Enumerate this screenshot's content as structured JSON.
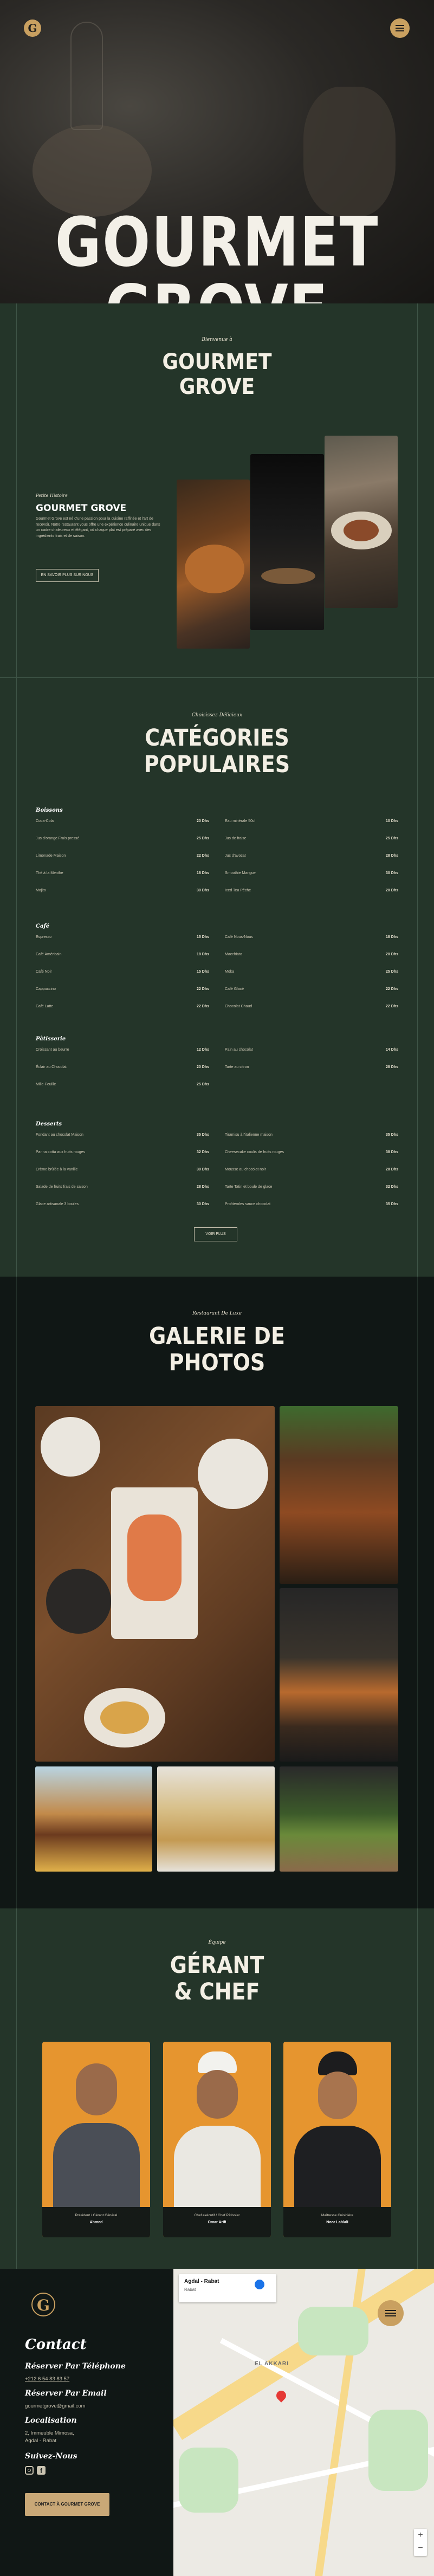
{
  "hero": {
    "title": "GOURMET GROVE",
    "logo_letter": "G"
  },
  "about": {
    "kicker": "Bienvenue à",
    "title_line1": "GOURMET",
    "title_line2": "GROVE",
    "small": "Petite Histoire",
    "name": "GOURMET GROVE",
    "text": "Gourmet Grove est né d'une passion pour la cuisine raffinée et l'art de recevoir. Notre restaurant vous offre une expérience culinaire unique dans un cadre chaleureux et élégant, où chaque plat est préparé avec des ingrédients frais et de saison.",
    "button": "EN SAVOIR PLUS SUR NOUS"
  },
  "menu": {
    "kicker": "Choisissez Délicieux",
    "title_line1": "CATÉGORIES",
    "title_line2": "POPULAIRES",
    "button": "VOIR PLUS",
    "categories": [
      {
        "name": "Boissons",
        "left": [
          [
            "Coca-Cola",
            "20 Dhs"
          ],
          [
            "Jus d'orange Frais pressé",
            "25 Dhs"
          ],
          [
            "Limonade Maison",
            "22 Dhs"
          ],
          [
            "Thé à la Menthe",
            "18 Dhs"
          ],
          [
            "Mojito",
            "30 Dhs"
          ]
        ],
        "right": [
          [
            "Eau minérale 50cl",
            "10 Dhs"
          ],
          [
            "Jus de fraise",
            "25 Dhs"
          ],
          [
            "Jus d'avocat",
            "28 Dhs"
          ],
          [
            "Smoothie Mangue",
            "30 Dhs"
          ],
          [
            "Iced Tea Pêche",
            "20 Dhs"
          ]
        ]
      },
      {
        "name": "Café",
        "left": [
          [
            "Espresso",
            "15 Dhs"
          ],
          [
            "Café Américain",
            "18 Dhs"
          ],
          [
            "Café Noir",
            "15 Dhs"
          ],
          [
            "Cappuccino",
            "22 Dhs"
          ],
          [
            "Café Latte",
            "22 Dhs"
          ]
        ],
        "right": [
          [
            "Café Nous-Nous",
            "18 Dhs"
          ],
          [
            "Macchiato",
            "20 Dhs"
          ],
          [
            "Moka",
            "25 Dhs"
          ],
          [
            "Café Glacé",
            "22 Dhs"
          ],
          [
            "Chocolat Chaud",
            "22 Dhs"
          ]
        ]
      },
      {
        "name": "Pâtisserie",
        "left": [
          [
            "Croissant au beurre",
            "12 Dhs"
          ],
          [
            "Éclair au Chocolat",
            "20 Dhs"
          ],
          [
            "Mille-Feuille",
            "25 Dhs"
          ]
        ],
        "right": [
          [
            "Pain au chocolat",
            "14 Dhs"
          ],
          [
            "Tarte au citron",
            "28 Dhs"
          ]
        ]
      },
      {
        "name": "Desserts",
        "left": [
          [
            "Fondant au chocolat Maison",
            "35 Dhs"
          ],
          [
            "Panna cotta aux fruits rouges",
            "32 Dhs"
          ],
          [
            "Crème brûlée à la vanille",
            "30 Dhs"
          ],
          [
            "Salade de fruits frais de saison",
            "28 Dhs"
          ],
          [
            "Glace artisanale 3 boules",
            "30 Dhs"
          ]
        ],
        "right": [
          [
            "Tiramisu à l'italienne maison",
            "35 Dhs"
          ],
          [
            "Cheesecake coulis de fruits rouges",
            "38 Dhs"
          ],
          [
            "Mousse au chocolat noir",
            "28 Dhs"
          ],
          [
            "Tarte Tatin et boule de glace",
            "32 Dhs"
          ],
          [
            "Profiteroles sauce chocolat",
            "35 Dhs"
          ]
        ]
      }
    ]
  },
  "gallery": {
    "kicker": "Restaurant De Luxe",
    "title_line1": "GALERIE DE",
    "title_line2": "PHOTOS"
  },
  "team": {
    "kicker": "Équipe",
    "title_line1": "GÉRANT",
    "title_line2": "& CHEF",
    "members": [
      {
        "title": "Président / Gérant Général",
        "name": "Ahmed"
      },
      {
        "title": "Chef exécutif / Chef Pâtissier",
        "name": "Omar Arifi"
      },
      {
        "title": "Maîtresse Cuisinière",
        "name": "Noor Lahlali"
      }
    ]
  },
  "contact": {
    "title": "Contact",
    "phone_label": "Réserver Par Téléphone",
    "phone": "+212 6 54 83 83 57",
    "email_label": "Réserver Par Email",
    "email": "gourmetgrove@gmail.com",
    "location_label": "Localisation",
    "location_line1": "2, Immeuble Mimosa,",
    "location_line2": "Agdal - Rabat",
    "follow_label": "Suivez-Nous",
    "button": "CONTACT À GOURMET GROVE",
    "map_place": "Agdal - Rabat",
    "map_subtitle": "Rabat",
    "map_label_area": "EL AKKARI"
  },
  "colors": {
    "accent": "#c9a060",
    "green": "#243529",
    "dark": "#101715",
    "orange": "#e6952f"
  }
}
